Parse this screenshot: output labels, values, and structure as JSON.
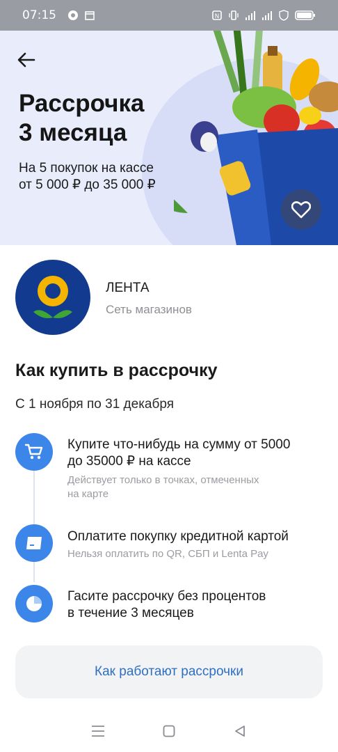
{
  "status_bar": {
    "time": "07:15",
    "icons": [
      "chrome-icon",
      "calendar-icon",
      "nfc-icon",
      "vibrate-icon",
      "signal-icon",
      "4g-signal-icon",
      "vpn-icon",
      "battery-icon"
    ]
  },
  "hero": {
    "title_line1": "Рассрочка",
    "title_line2": "3 месяца",
    "subtitle_line1": "На 5 покупок на кассе",
    "subtitle_line2": "от 5 000 ₽ до 35 000 ₽",
    "colors": {
      "background": "#e8ecfb",
      "blob": "#d8ddf7"
    }
  },
  "merchant": {
    "name": "ЛЕНТА",
    "type": "Сеть магазинов",
    "logo_color": "#123b8f"
  },
  "how_to": {
    "title": "Как купить в рассрочку",
    "period": "С 1 ноября по 31 декабря",
    "steps": [
      {
        "icon": "cart-icon",
        "title_line1": "Купите что-нибудь на сумму от 5000",
        "title_line2": "до 35000 ₽ на кассе",
        "note_line1": "Действует только в точках, отмеченных",
        "note_line2": "на карте"
      },
      {
        "icon": "credit-card-icon",
        "title_line1": "Оплатите покупку кредитной картой",
        "note_line1": "Нельзя оплатить по QR, СБП и Lenta Pay"
      },
      {
        "icon": "pie-chart-icon",
        "title_line1": "Гасите рассрочку без процентов",
        "title_line2": "в течение 3 месяцев"
      }
    ],
    "accent_color": "#3b86e8"
  },
  "button": {
    "label": "Как работают рассрочки"
  },
  "nav": {
    "icons": [
      "menu-icon",
      "home-square-icon",
      "back-triangle-icon"
    ]
  }
}
